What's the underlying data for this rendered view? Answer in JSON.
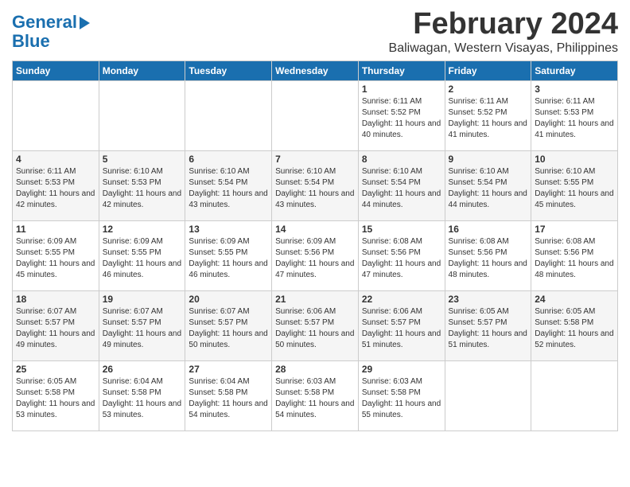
{
  "logo": {
    "line1": "General",
    "line2": "Blue"
  },
  "title": "February 2024",
  "location": "Baliwagan, Western Visayas, Philippines",
  "days_header": [
    "Sunday",
    "Monday",
    "Tuesday",
    "Wednesday",
    "Thursday",
    "Friday",
    "Saturday"
  ],
  "weeks": [
    [
      {
        "day": "",
        "info": ""
      },
      {
        "day": "",
        "info": ""
      },
      {
        "day": "",
        "info": ""
      },
      {
        "day": "",
        "info": ""
      },
      {
        "day": "1",
        "info": "Sunrise: 6:11 AM\nSunset: 5:52 PM\nDaylight: 11 hours and 40 minutes."
      },
      {
        "day": "2",
        "info": "Sunrise: 6:11 AM\nSunset: 5:52 PM\nDaylight: 11 hours and 41 minutes."
      },
      {
        "day": "3",
        "info": "Sunrise: 6:11 AM\nSunset: 5:53 PM\nDaylight: 11 hours and 41 minutes."
      }
    ],
    [
      {
        "day": "4",
        "info": "Sunrise: 6:11 AM\nSunset: 5:53 PM\nDaylight: 11 hours and 42 minutes."
      },
      {
        "day": "5",
        "info": "Sunrise: 6:10 AM\nSunset: 5:53 PM\nDaylight: 11 hours and 42 minutes."
      },
      {
        "day": "6",
        "info": "Sunrise: 6:10 AM\nSunset: 5:54 PM\nDaylight: 11 hours and 43 minutes."
      },
      {
        "day": "7",
        "info": "Sunrise: 6:10 AM\nSunset: 5:54 PM\nDaylight: 11 hours and 43 minutes."
      },
      {
        "day": "8",
        "info": "Sunrise: 6:10 AM\nSunset: 5:54 PM\nDaylight: 11 hours and 44 minutes."
      },
      {
        "day": "9",
        "info": "Sunrise: 6:10 AM\nSunset: 5:54 PM\nDaylight: 11 hours and 44 minutes."
      },
      {
        "day": "10",
        "info": "Sunrise: 6:10 AM\nSunset: 5:55 PM\nDaylight: 11 hours and 45 minutes."
      }
    ],
    [
      {
        "day": "11",
        "info": "Sunrise: 6:09 AM\nSunset: 5:55 PM\nDaylight: 11 hours and 45 minutes."
      },
      {
        "day": "12",
        "info": "Sunrise: 6:09 AM\nSunset: 5:55 PM\nDaylight: 11 hours and 46 minutes."
      },
      {
        "day": "13",
        "info": "Sunrise: 6:09 AM\nSunset: 5:55 PM\nDaylight: 11 hours and 46 minutes."
      },
      {
        "day": "14",
        "info": "Sunrise: 6:09 AM\nSunset: 5:56 PM\nDaylight: 11 hours and 47 minutes."
      },
      {
        "day": "15",
        "info": "Sunrise: 6:08 AM\nSunset: 5:56 PM\nDaylight: 11 hours and 47 minutes."
      },
      {
        "day": "16",
        "info": "Sunrise: 6:08 AM\nSunset: 5:56 PM\nDaylight: 11 hours and 48 minutes."
      },
      {
        "day": "17",
        "info": "Sunrise: 6:08 AM\nSunset: 5:56 PM\nDaylight: 11 hours and 48 minutes."
      }
    ],
    [
      {
        "day": "18",
        "info": "Sunrise: 6:07 AM\nSunset: 5:57 PM\nDaylight: 11 hours and 49 minutes."
      },
      {
        "day": "19",
        "info": "Sunrise: 6:07 AM\nSunset: 5:57 PM\nDaylight: 11 hours and 49 minutes."
      },
      {
        "day": "20",
        "info": "Sunrise: 6:07 AM\nSunset: 5:57 PM\nDaylight: 11 hours and 50 minutes."
      },
      {
        "day": "21",
        "info": "Sunrise: 6:06 AM\nSunset: 5:57 PM\nDaylight: 11 hours and 50 minutes."
      },
      {
        "day": "22",
        "info": "Sunrise: 6:06 AM\nSunset: 5:57 PM\nDaylight: 11 hours and 51 minutes."
      },
      {
        "day": "23",
        "info": "Sunrise: 6:05 AM\nSunset: 5:57 PM\nDaylight: 11 hours and 51 minutes."
      },
      {
        "day": "24",
        "info": "Sunrise: 6:05 AM\nSunset: 5:58 PM\nDaylight: 11 hours and 52 minutes."
      }
    ],
    [
      {
        "day": "25",
        "info": "Sunrise: 6:05 AM\nSunset: 5:58 PM\nDaylight: 11 hours and 53 minutes."
      },
      {
        "day": "26",
        "info": "Sunrise: 6:04 AM\nSunset: 5:58 PM\nDaylight: 11 hours and 53 minutes."
      },
      {
        "day": "27",
        "info": "Sunrise: 6:04 AM\nSunset: 5:58 PM\nDaylight: 11 hours and 54 minutes."
      },
      {
        "day": "28",
        "info": "Sunrise: 6:03 AM\nSunset: 5:58 PM\nDaylight: 11 hours and 54 minutes."
      },
      {
        "day": "29",
        "info": "Sunrise: 6:03 AM\nSunset: 5:58 PM\nDaylight: 11 hours and 55 minutes."
      },
      {
        "day": "",
        "info": ""
      },
      {
        "day": "",
        "info": ""
      }
    ]
  ]
}
